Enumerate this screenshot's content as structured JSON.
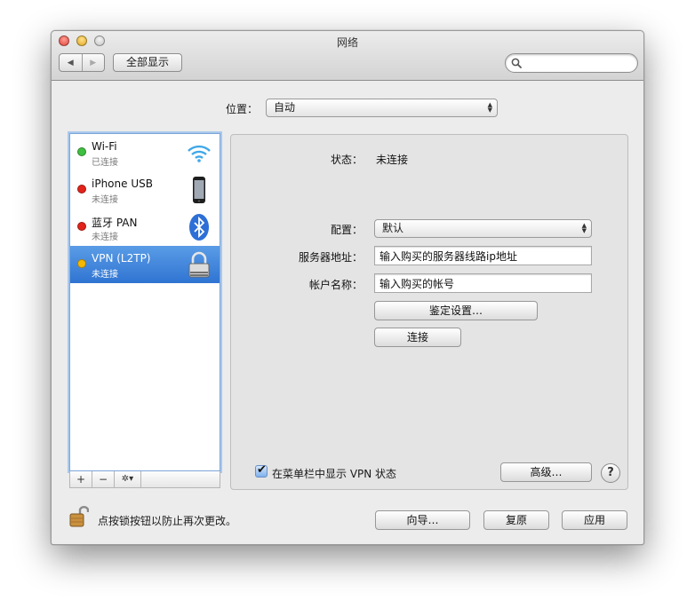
{
  "window": {
    "title": "网络"
  },
  "toolbar": {
    "show_all": "全部显示",
    "search_placeholder": ""
  },
  "location": {
    "label": "位置：",
    "value": "自动"
  },
  "services": [
    {
      "name": "Wi-Fi",
      "status": "已连接",
      "dot": "#3fbf3f",
      "icon": "wifi-icon"
    },
    {
      "name": "iPhone USB",
      "status": "未连接",
      "dot": "#e2231a",
      "icon": "iphone-icon"
    },
    {
      "name": "蓝牙 PAN",
      "status": "未连接",
      "dot": "#e2231a",
      "icon": "bluetooth-icon"
    },
    {
      "name": "VPN (L2TP)",
      "status": "未连接",
      "dot": "#f5b800",
      "icon": "vpn-lock-icon",
      "selected": true
    }
  ],
  "list_toolbar": {
    "add": "+",
    "remove": "−",
    "gear": "✲▾"
  },
  "detail": {
    "status_label": "状态：",
    "status_value": "未连接",
    "config_label": "配置：",
    "config_value": "默认",
    "server_label": "服务器地址：",
    "server_value": "输入购买的服务器线路ip地址",
    "account_label": "帐户名称：",
    "account_value": "输入购买的帐号",
    "auth_button": "鉴定设置…",
    "connect_button": "连接",
    "show_status_label": "在菜单栏中显示 VPN 状态",
    "show_status_checked": true,
    "advanced_button": "高级…",
    "help": "?"
  },
  "footer": {
    "lock_text": "点按锁按钮以防止再次更改。",
    "assistant_button": "向导…",
    "revert_button": "复原",
    "apply_button": "应用"
  },
  "colors": {
    "selection": "#3a80d8",
    "focus_ring": "#a9c8ec"
  }
}
